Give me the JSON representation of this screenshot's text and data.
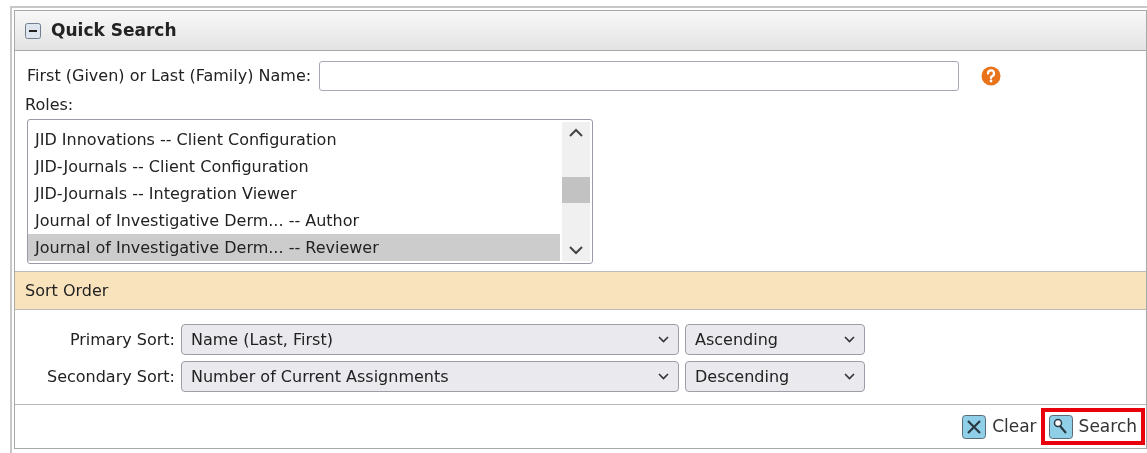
{
  "panel": {
    "title": "Quick Search",
    "collapsed": false
  },
  "name_field": {
    "label": "First (Given) or Last (Family) Name:"
  },
  "roles": {
    "label": "Roles:",
    "items": [
      {
        "text": "JID Innovations -- Client Configuration",
        "selected": false
      },
      {
        "text": "JID-Journals -- Client Configuration",
        "selected": false
      },
      {
        "text": "JID-Journals -- Integration Viewer",
        "selected": false
      },
      {
        "text": "Journal of Investigative Derm... -- Author",
        "selected": false
      },
      {
        "text": "Journal of Investigative Derm... -- Reviewer",
        "selected": true
      }
    ]
  },
  "sort_order": {
    "title": "Sort Order",
    "rows": [
      {
        "label": "Primary Sort:",
        "field": "Name (Last, First)",
        "direction": "Ascending"
      },
      {
        "label": "Secondary Sort:",
        "field": "Number of Current Assignments",
        "direction": "Descending"
      }
    ]
  },
  "buttons": [
    {
      "kind": "clear",
      "label": "Clear",
      "highlighted": false
    },
    {
      "kind": "search",
      "label": "Search",
      "highlighted": true
    }
  ]
}
